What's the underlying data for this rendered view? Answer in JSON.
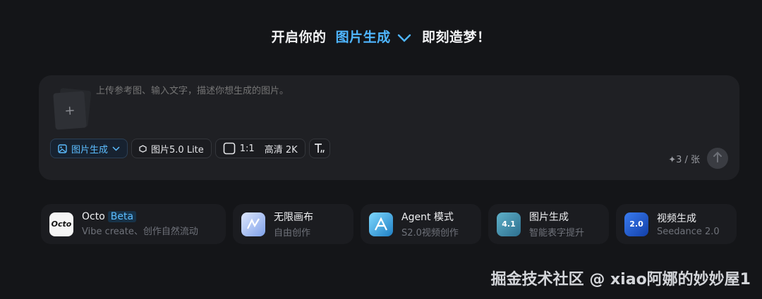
{
  "headline": {
    "prefix": "开启你的",
    "mode": "图片生成",
    "suffix": "即刻造梦！"
  },
  "composer": {
    "upload_glyph": "+",
    "placeholder": "上传参考图、输入文字，描述你想生成的图片。",
    "toolbar": {
      "mode_label": "图片生成",
      "model_label": "图片5.0 Lite",
      "ratio_label": "1:1",
      "quality_label": "高清 2K"
    },
    "credits": "✦3 / 张"
  },
  "cards": [
    {
      "title": "Octo",
      "badge": "Beta",
      "subtitle": "Vibe create、创作自然流动",
      "icon_text": "Octo",
      "icon": "octo-logo-icon",
      "color": "#f5f5f5"
    },
    {
      "title": "无限画布",
      "subtitle": "自由创作",
      "icon": "canvas-icon",
      "color": "#8fb3ff"
    },
    {
      "title": "Agent 模式",
      "subtitle": "S2.0视频创作",
      "icon": "agent-icon",
      "color": "#2a9fd8"
    },
    {
      "title": "图片生成",
      "subtitle": "智能表字提升",
      "icon_text": "4.1",
      "icon": "image-gen-icon",
      "color": "#3f8fb0"
    },
    {
      "title": "视频生成",
      "subtitle": "Seedance 2.0",
      "icon_text": "2.0",
      "icon": "video-gen-icon",
      "color": "#1b5fd8"
    }
  ],
  "watermark": "掘金技术社区 @ xiao阿娜的妙妙屋1"
}
